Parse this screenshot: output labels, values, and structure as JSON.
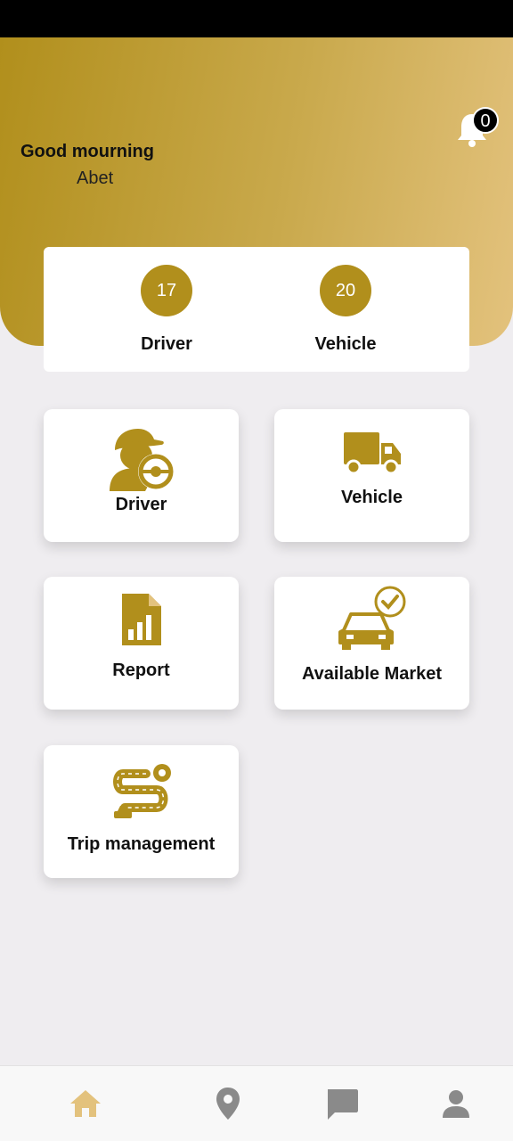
{
  "header": {
    "greeting": "Good mourning",
    "user_name": "Abet",
    "notification_count": "0"
  },
  "stats": [
    {
      "value": "17",
      "label": "Driver"
    },
    {
      "value": "20",
      "label": "Vehicle"
    }
  ],
  "menu": {
    "driver": "Driver",
    "vehicle": "Vehicle",
    "report": "Report",
    "available_market": "Available Market",
    "trip_management": "Trip management"
  },
  "bottom_nav": [
    "home-icon",
    "location-pin-icon",
    "chat-icon",
    "profile-icon"
  ],
  "colors": {
    "accent": "#b18f1c",
    "accent_light": "#e3c27d",
    "nav_active": "#e3c27d",
    "nav_inactive": "#8a8a8a"
  }
}
